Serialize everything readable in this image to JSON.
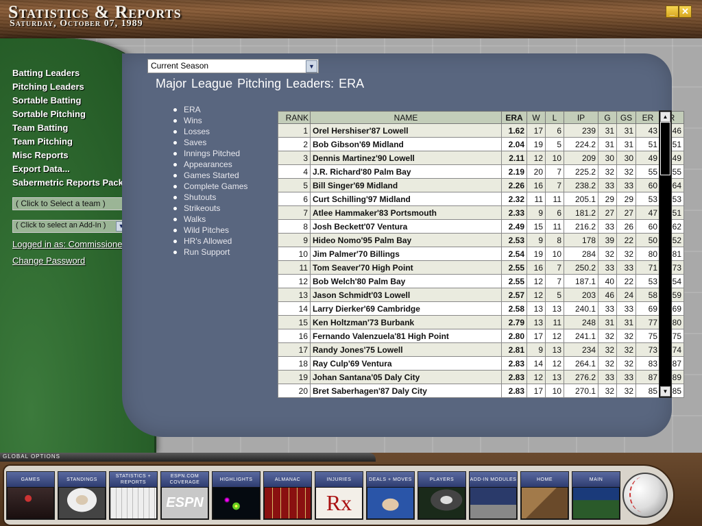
{
  "window": {
    "title": "Statistics & Reports",
    "date": "Saturday, October 07, 1989",
    "minimize_glyph": "_",
    "close_glyph": "✕"
  },
  "sidebar": {
    "items": [
      {
        "label": "Batting Leaders"
      },
      {
        "label": "Pitching Leaders"
      },
      {
        "label": "Sortable Batting"
      },
      {
        "label": "Sortable Pitching"
      },
      {
        "label": "Team Batting"
      },
      {
        "label": "Team Pitching"
      },
      {
        "label": "Misc Reports"
      },
      {
        "label": "Export Data..."
      },
      {
        "label": "Sabermetric Reports Pack"
      }
    ],
    "team_select": "( Click to Select a team )",
    "addin_select": "( Click to select an Add-In )",
    "logged_in": "Logged in as: Commissioner.",
    "change_password": "Change Password"
  },
  "main": {
    "season_select": "Current Season",
    "heading": "Major League Pitching Leaders: ERA",
    "categories": [
      "ERA",
      "Wins",
      "Losses",
      "Saves",
      "Innings Pitched",
      "Appearances",
      "Games Started",
      "Complete Games",
      "Shutouts",
      "Strikeouts",
      "Walks",
      "Wild Pitches",
      "HR's Allowed",
      "Run Support"
    ]
  },
  "table": {
    "columns": [
      "RANK",
      "NAME",
      "ERA",
      "W",
      "L",
      "IP",
      "G",
      "GS",
      "ER",
      "R"
    ],
    "rows": [
      [
        "1",
        "Orel Hershiser'87 Lowell",
        "1.62",
        "17",
        "6",
        "239",
        "31",
        "31",
        "43",
        "46"
      ],
      [
        "2",
        "Bob Gibson'69 Midland",
        "2.04",
        "19",
        "5",
        "224.2",
        "31",
        "31",
        "51",
        "51"
      ],
      [
        "3",
        "Dennis Martinez'90 Lowell",
        "2.11",
        "12",
        "10",
        "209",
        "30",
        "30",
        "49",
        "49"
      ],
      [
        "4",
        "J.R. Richard'80 Palm Bay",
        "2.19",
        "20",
        "7",
        "225.2",
        "32",
        "32",
        "55",
        "55"
      ],
      [
        "5",
        "Bill Singer'69 Midland",
        "2.26",
        "16",
        "7",
        "238.2",
        "33",
        "33",
        "60",
        "64"
      ],
      [
        "6",
        "Curt Schilling'97 Midland",
        "2.32",
        "11",
        "11",
        "205.1",
        "29",
        "29",
        "53",
        "53"
      ],
      [
        "7",
        "Atlee Hammaker'83 Portsmouth",
        "2.33",
        "9",
        "6",
        "181.2",
        "27",
        "27",
        "47",
        "51"
      ],
      [
        "8",
        "Josh Beckett'07 Ventura",
        "2.49",
        "15",
        "11",
        "216.2",
        "33",
        "26",
        "60",
        "62"
      ],
      [
        "9",
        "Hideo Nomo'95 Palm Bay",
        "2.53",
        "9",
        "8",
        "178",
        "39",
        "22",
        "50",
        "52"
      ],
      [
        "10",
        "Jim Palmer'70 Billings",
        "2.54",
        "19",
        "10",
        "284",
        "32",
        "32",
        "80",
        "81"
      ],
      [
        "11",
        "Tom Seaver'70 High Point",
        "2.55",
        "16",
        "7",
        "250.2",
        "33",
        "33",
        "71",
        "73"
      ],
      [
        "12",
        "Bob Welch'80 Palm Bay",
        "2.55",
        "12",
        "7",
        "187.1",
        "40",
        "22",
        "53",
        "54"
      ],
      [
        "13",
        "Jason Schmidt'03 Lowell",
        "2.57",
        "12",
        "5",
        "203",
        "46",
        "24",
        "58",
        "59"
      ],
      [
        "14",
        "Larry Dierker'69 Cambridge",
        "2.58",
        "13",
        "13",
        "240.1",
        "33",
        "33",
        "69",
        "69"
      ],
      [
        "15",
        "Ken Holtzman'73 Burbank",
        "2.79",
        "13",
        "11",
        "248",
        "31",
        "31",
        "77",
        "80"
      ],
      [
        "16",
        "Fernando Valenzuela'81 High Point",
        "2.80",
        "17",
        "12",
        "241.1",
        "32",
        "32",
        "75",
        "75"
      ],
      [
        "17",
        "Randy Jones'75 Lowell",
        "2.81",
        "9",
        "13",
        "234",
        "32",
        "32",
        "73",
        "74"
      ],
      [
        "18",
        "Ray Culp'69 Ventura",
        "2.83",
        "14",
        "12",
        "264.1",
        "32",
        "32",
        "83",
        "87"
      ],
      [
        "19",
        "Johan Santana'05 Daly City",
        "2.83",
        "12",
        "13",
        "276.2",
        "33",
        "33",
        "87",
        "89"
      ],
      [
        "20",
        "Bret Saberhagen'87 Daly City",
        "2.83",
        "17",
        "10",
        "270.1",
        "32",
        "32",
        "85",
        "85"
      ]
    ]
  },
  "bottom": {
    "global_options": "GLOBAL OPTIONS",
    "tiles": [
      {
        "label": "GAMES"
      },
      {
        "label": "STANDINGS"
      },
      {
        "label": "STATISTICS + REPORTS"
      },
      {
        "label": "ESPN.COM COVERAGE"
      },
      {
        "label": "HIGHLIGHTS"
      },
      {
        "label": "ALMANAC"
      },
      {
        "label": "INJURIES"
      },
      {
        "label": "DEALS + MOVES"
      },
      {
        "label": "PLAYERS"
      },
      {
        "label": "ADD-IN MODULES"
      },
      {
        "label": "HOME"
      },
      {
        "label": "MAIN"
      }
    ],
    "espn_text": "ESPN",
    "injuries_glyph": "Rx"
  }
}
